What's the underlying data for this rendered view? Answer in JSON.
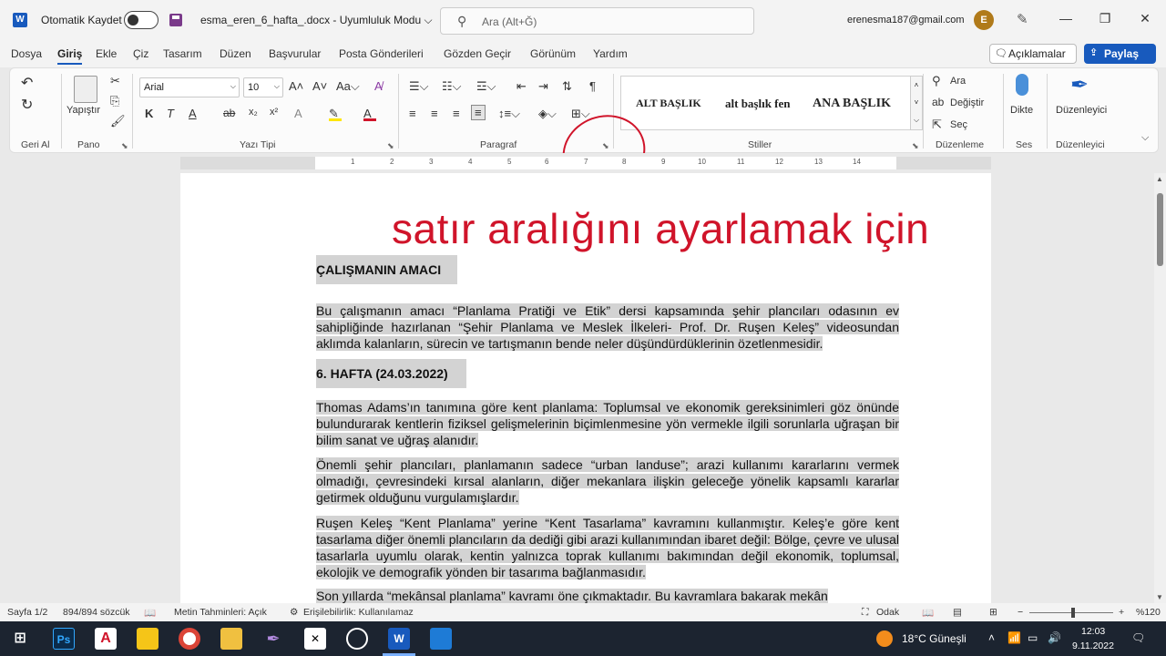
{
  "titlebar": {
    "autosave_label": "Otomatik Kaydet",
    "doc_title": "esma_eren_6_hafta_.docx  -  Uyumluluk Modu ⌵",
    "search_placeholder": "Ara (Alt+Ğ)",
    "email": "erenesma187@gmail.com",
    "avatar_initial": "E",
    "minimize": "—",
    "restore": "❐",
    "close": "✕"
  },
  "menu": {
    "tabs": [
      "Dosya",
      "Giriş",
      "Ekle",
      "Çiz",
      "Tasarım",
      "Düzen",
      "Başvurular",
      "Posta Gönderileri",
      "Gözden Geçir",
      "Görünüm",
      "Yardım"
    ],
    "comments": "Açıklamalar",
    "share": "Paylaş"
  },
  "ribbon": {
    "undo_group": "Geri Al",
    "clipboard_group": "Pano",
    "paste_label": "Yapıştır",
    "font_group": "Yazı Tipi",
    "font_name": "Arial",
    "font_size": "10",
    "paragraph_group": "Paragraf",
    "styles_group": "Stiller",
    "style_items": [
      "ALT BAŞLIK",
      "alt başlık fen",
      "ANA BAŞLIK"
    ],
    "editing_group": "Düzenleme",
    "find": "Ara",
    "replace": "Değiştir",
    "select": "Seç",
    "voice_group": "Ses",
    "dictate": "Dikte",
    "editor_group": "Düzenleyici",
    "editor": "Düzenleyici",
    "bold": "K",
    "italic": "T",
    "underline": "A",
    "strike": "ab",
    "sub": "x₂",
    "sup": "x²"
  },
  "ruler_numbers": [
    "1",
    "2",
    "3",
    "4",
    "5",
    "6",
    "7",
    "8",
    "9",
    "10",
    "11",
    "12",
    "13",
    "14"
  ],
  "document": {
    "overlay_annotation": "satır aralığını ayarlamak için",
    "heading1": "ÇALIŞMANIN AMACI",
    "para1": "Bu çalışmanın amacı “Planlama Pratiği ve Etik” dersi kapsamında şehir plancıları odasının ev sahipliğinde hazırlanan “Şehir Planlama ve Meslek İlkeleri- Prof. Dr. Ruşen Keleş” videosundan aklımda kalanların, sürecin ve tartışmanın bende neler düşündürdüklerinin özetlenmesidir.",
    "heading2": "6. HAFTA (24.03.2022)",
    "para2": "Thomas Adams’ın tanımına göre kent planlama: Toplumsal ve ekonomik gereksinimleri göz önünde bulundurarak kentlerin fiziksel gelişmelerinin biçimlenmesine yön vermekle ilgili sorunlarla uğraşan bir bilim sanat ve uğraş alanıdır.",
    "para3": "Önemli şehir plancıları, planlamanın sadece “urban landuse”; arazi kullanımı kararlarını vermek olmadığı, çevresindeki kırsal alanların, diğer mekanlara ilişkin geleceğe yönelik kapsamlı kararlar getirmek olduğunu vurgulamışlardır.",
    "para4": "Ruşen Keleş “Kent Planlama” yerine “Kent Tasarlama” kavramını kullanmıştır. Keleş’e göre kent tasarlama diğer önemli plancıların da dediği gibi arazi kullanımından ibaret değil: Bölge, çevre ve ulusal tasarlarla uyumlu olarak, kentin yalnızca toprak kullanımı bakımından değil ekonomik, toplumsal, ekolojik ve demografik yönden bir tasarıma bağlanmasıdır.",
    "para5": "Son yıllarda “mekânsal planlama” kavramı öne çıkmaktadır. Bu kavramlara bakarak mekân"
  },
  "status": {
    "page": "Sayfa 1/2",
    "words": "894/894 sözcük",
    "text_predictions": "Metin Tahminleri: Açık",
    "accessibility": "Erişilebilirlik: Kullanılamaz",
    "focus": "Odak",
    "zoom": "%120"
  },
  "taskbar": {
    "weather": "18°C  Güneşli",
    "time": "12:03",
    "date": "9.11.2022"
  },
  "colors": {
    "accent": "#185abd",
    "annotation": "#d0142a",
    "highlight": "#d3d3d3"
  }
}
